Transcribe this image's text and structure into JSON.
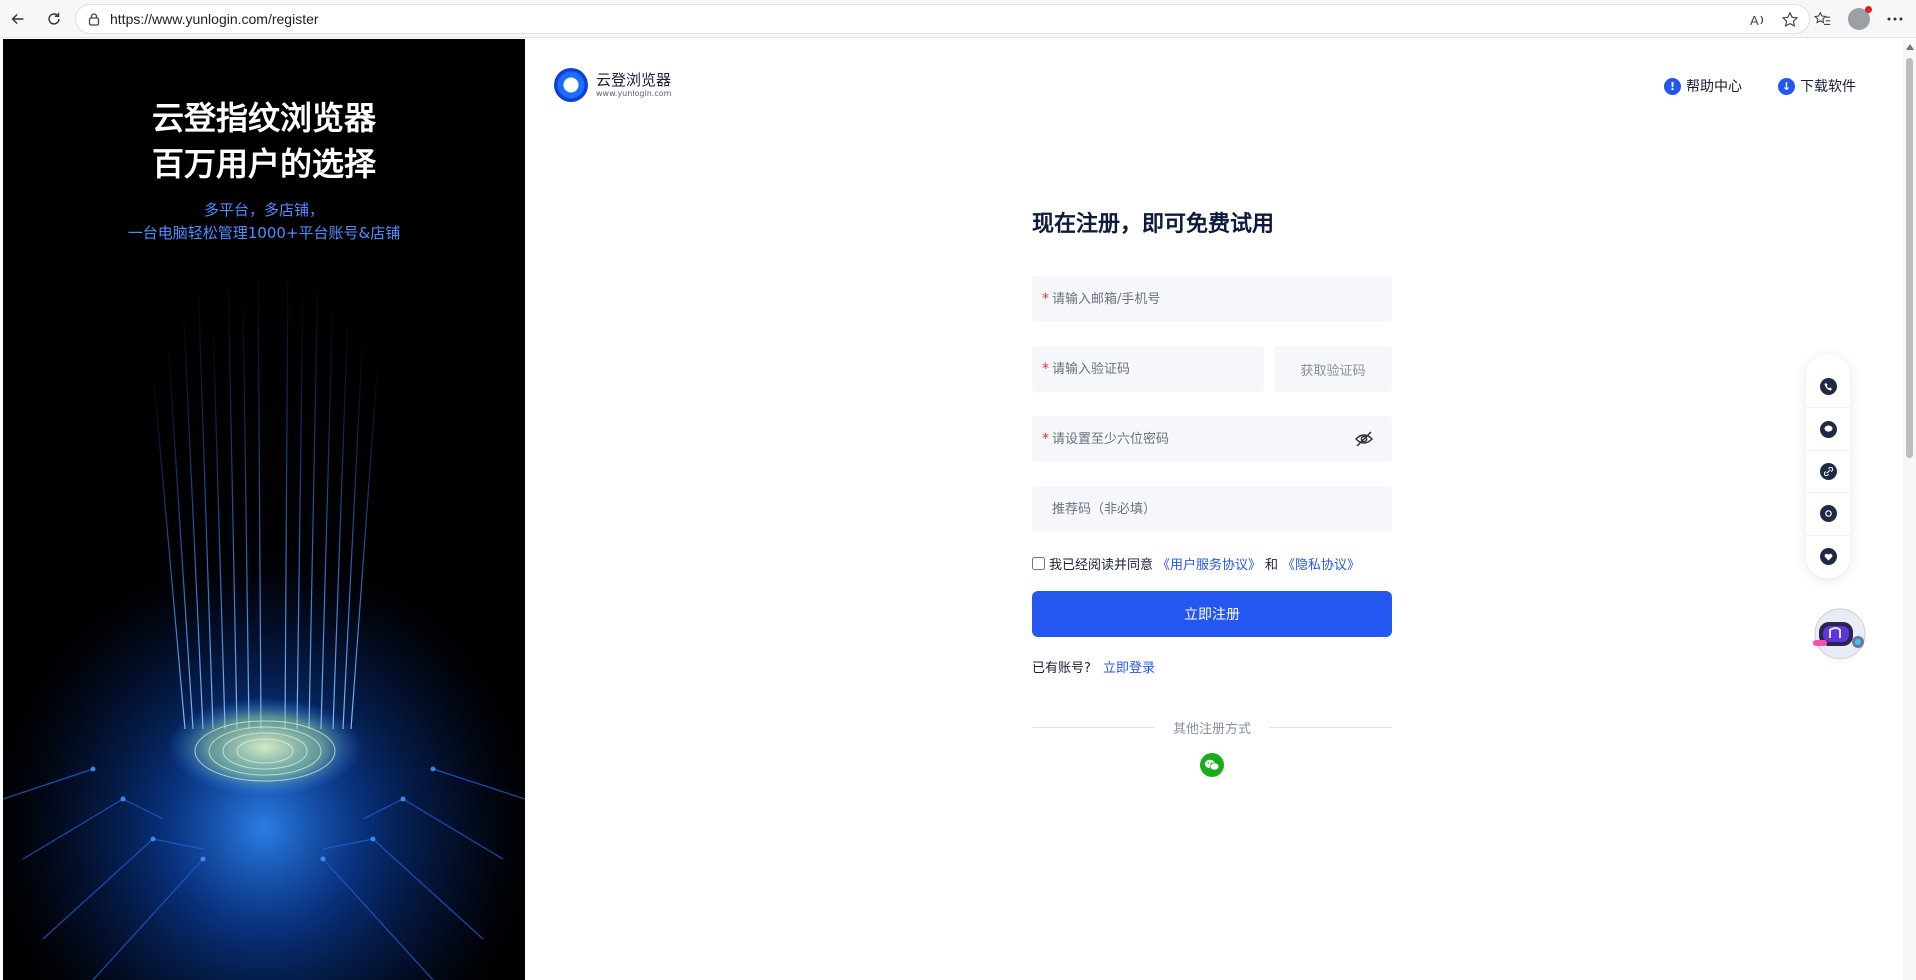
{
  "browser": {
    "url": "https://www.yunlogin.com/register"
  },
  "hero": {
    "title_line1": "云登指纹浏览器",
    "title_line2": "百万用户的选择",
    "sub_line1": "多平台，多店铺，",
    "sub_line2": "一台电脑轻松管理1000+平台账号&店铺"
  },
  "header": {
    "logo_name": "云登浏览器",
    "logo_url": "www.yunlogin.com",
    "help_label": "帮助中心",
    "download_label": "下载软件"
  },
  "form": {
    "title": "现在注册，即可免费试用",
    "account_placeholder": "请输入邮箱/手机号",
    "code_placeholder": "请输入验证码",
    "get_code_label": "获取验证码",
    "password_placeholder": "请设置至少六位密码",
    "referral_placeholder": "推荐码（非必填）",
    "agree_prefix": "我已经阅读并同意",
    "terms_label": "《用户服务协议》",
    "and_label": "和",
    "privacy_label": "《隐私协议》",
    "submit_label": "立即注册",
    "have_account": "已有账号?",
    "login_label": "立即登录",
    "other_methods": "其他注册方式",
    "required_mark": "*"
  },
  "colors": {
    "accent": "#2456f0",
    "hero_bg": "#000000",
    "hero_sub": "#4f8cff",
    "wechat": "#1aad19"
  }
}
